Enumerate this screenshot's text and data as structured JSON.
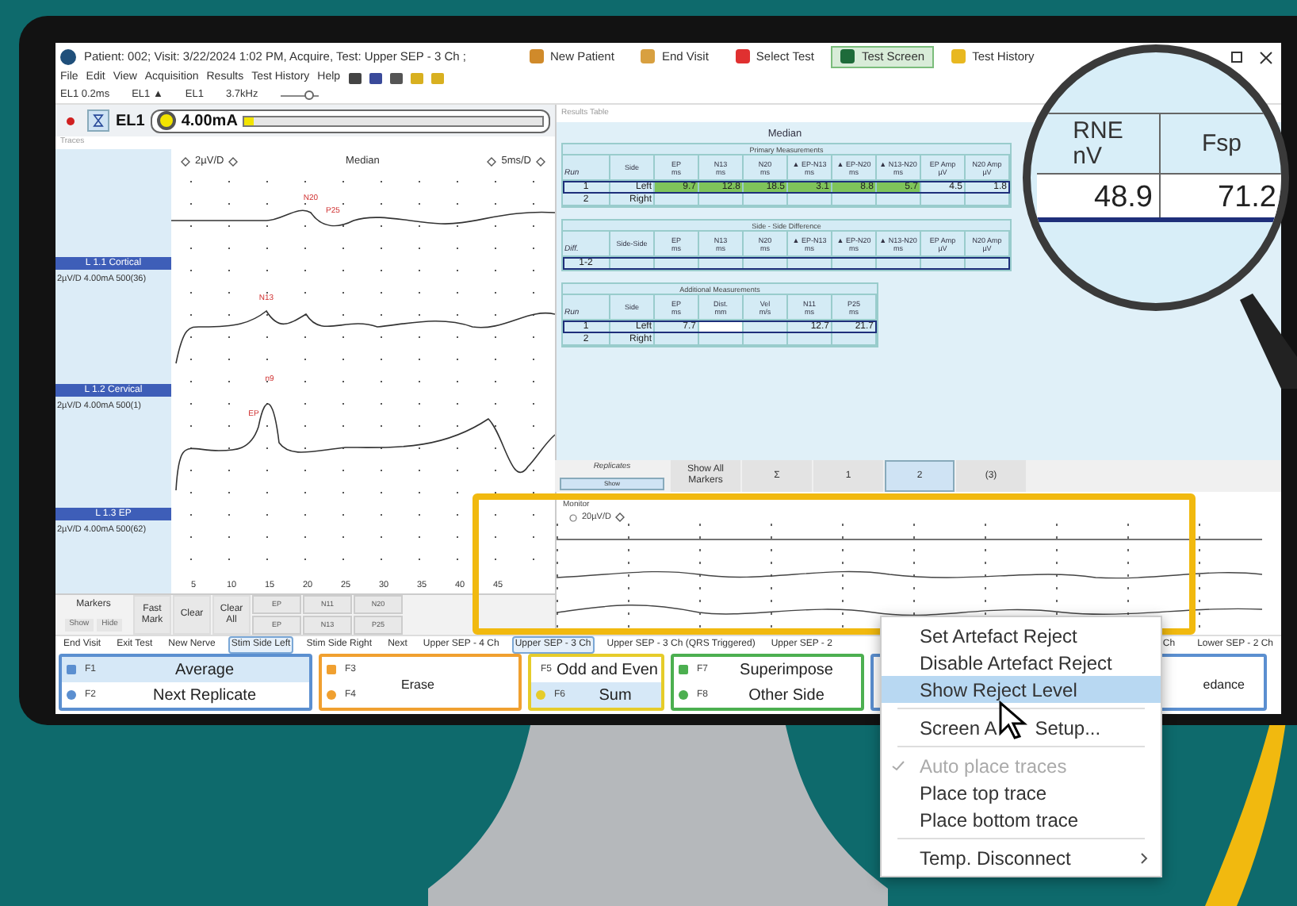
{
  "window": {
    "title": "Patient: 002;  Visit: 3/22/2024 1:02 PM, Acquire, Test: Upper SEP - 3 Ch ;"
  },
  "toolbar": [
    {
      "label": "New Patient",
      "selected": false
    },
    {
      "label": "End Visit",
      "selected": false
    },
    {
      "label": "Select Test",
      "selected": false
    },
    {
      "label": "Test Screen",
      "selected": true
    },
    {
      "label": "Test History",
      "selected": false
    }
  ],
  "menu": [
    "File",
    "Edit",
    "View",
    "Acquisition",
    "Results",
    "Test History",
    "Help"
  ],
  "settings_bar": {
    "fields": [
      "EL1 0.2ms",
      "EL1 ▲",
      "EL1",
      "3.7kHz"
    ],
    "level": 0.75
  },
  "stimulator": {
    "channel": "EL1",
    "current": "4.00mA",
    "level": 0.03
  },
  "traces": {
    "title": "Traces",
    "gain": "2µV/D",
    "mode": "Median",
    "timebase": "5ms/D",
    "channels": [
      {
        "name": "L 1.1 Cortical",
        "info": "2µV/D 4.00mA 500(36)",
        "markers": [
          "N20",
          "P25"
        ]
      },
      {
        "name": "L 1.2 Cervical",
        "info": "2µV/D 4.00mA 500(1)",
        "markers": [
          "N13"
        ]
      },
      {
        "name": "L 1.3 EP",
        "info": "2µV/D 4.00mA 500(62)",
        "markers": [
          "EP",
          "n9"
        ]
      }
    ],
    "x_ticks": [
      "5",
      "10",
      "15",
      "20",
      "25",
      "30",
      "35",
      "40",
      "45"
    ]
  },
  "markers_panel": {
    "title": "Markers",
    "show": "Show",
    "hide": "Hide",
    "buttons": [
      "Fast Mark",
      "Clear",
      "Clear All"
    ],
    "markers": [
      "EP",
      "N11",
      "N20",
      "EP",
      "N13",
      "P25"
    ]
  },
  "results": {
    "title": "Results Table",
    "heading": "Median",
    "tables": [
      {
        "title": "Primary Measurements",
        "columns": [
          {
            "name": "Run"
          },
          {
            "name": "Side"
          },
          {
            "name": "EP",
            "unit": "ms"
          },
          {
            "name": "N13",
            "unit": "ms"
          },
          {
            "name": "N20",
            "unit": "ms"
          },
          {
            "name": "▲ EP-N13",
            "unit": "ms"
          },
          {
            "name": "▲ EP-N20",
            "unit": "ms"
          },
          {
            "name": "▲ N13-N20",
            "unit": "ms"
          },
          {
            "name": "EP Amp",
            "unit": "µV"
          },
          {
            "name": "N20 Amp",
            "unit": "µV"
          }
        ],
        "rows": [
          {
            "selected": true,
            "cells": [
              {
                "text": "1",
                "highlighted": false
              },
              {
                "text": "Left",
                "highlighted": false
              },
              {
                "text": "9.7",
                "highlighted": true
              },
              {
                "text": "12.8",
                "highlighted": true
              },
              {
                "text": "18.5",
                "highlighted": true
              },
              {
                "text": "3.1",
                "highlighted": true
              },
              {
                "text": "8.8",
                "highlighted": true
              },
              {
                "text": "5.7",
                "highlighted": true
              },
              {
                "text": "4.5",
                "highlighted": false
              },
              {
                "text": "1.8",
                "highlighted": false
              }
            ]
          },
          {
            "selected": false,
            "cells": [
              {
                "text": "2",
                "highlighted": false
              },
              {
                "text": "Right",
                "highlighted": false
              }
            ]
          }
        ]
      },
      {
        "title": "Side - Side Difference",
        "columns": [
          {
            "name": "Diff."
          },
          {
            "name": "Side-Side"
          },
          {
            "name": "EP",
            "unit": "ms"
          },
          {
            "name": "N13",
            "unit": "ms"
          },
          {
            "name": "N20",
            "unit": "ms"
          },
          {
            "name": "▲ EP-N13",
            "unit": "ms"
          },
          {
            "name": "▲ EP-N20",
            "unit": "ms"
          },
          {
            "name": "▲ N13-N20",
            "unit": "ms"
          },
          {
            "name": "EP Amp",
            "unit": "µV"
          },
          {
            "name": "N20 Amp",
            "unit": "µV"
          }
        ],
        "rows": [
          {
            "selected": true,
            "cells": [
              {
                "text": "1-2",
                "highlighted": false
              }
            ]
          }
        ]
      },
      {
        "title": "Additional Measurements",
        "columns": [
          {
            "name": "Run"
          },
          {
            "name": "Side"
          },
          {
            "name": "EP",
            "unit": "ms"
          },
          {
            "name": "Dist.",
            "unit": "mm"
          },
          {
            "name": "Vel",
            "unit": "m/s"
          },
          {
            "name": "N11",
            "unit": "ms"
          },
          {
            "name": "P25",
            "unit": "ms"
          }
        ],
        "rows": [
          {
            "selected": true,
            "cells": [
              {
                "text": "1",
                "highlighted": false
              },
              {
                "text": "Left",
                "highlighted": false
              },
              {
                "text": "7.7",
                "highlighted": false
              },
              {
                "text": "",
                "editing": true
              },
              {
                "text": ""
              },
              {
                "text": "12.7",
                "highlighted": false
              },
              {
                "text": "21.7",
                "highlighted": false
              }
            ]
          },
          {
            "selected": false,
            "cells": [
              {
                "text": "2",
                "highlighted": false
              },
              {
                "text": "Right",
                "highlighted": false
              }
            ]
          }
        ]
      }
    ]
  },
  "magnifier": {
    "columns": [
      {
        "name": "RNE",
        "unit": "nV"
      },
      {
        "name": "Fsp"
      }
    ],
    "values": [
      "48.9",
      "71.2"
    ]
  },
  "replicates": {
    "title": "Replicates",
    "show": "Show",
    "tabs": [
      {
        "label": "Show All Markers",
        "selected": false
      },
      {
        "label": "Σ",
        "selected": false
      },
      {
        "label": "1",
        "selected": false
      },
      {
        "label": "2",
        "selected": true
      },
      {
        "label": "(3)",
        "selected": false
      }
    ]
  },
  "monitor": {
    "title": "Monitor",
    "gain": "20µV/D"
  },
  "protocol_bar": {
    "left": [
      {
        "label": "End Visit",
        "selected": false
      },
      {
        "label": "Exit Test",
        "selected": false
      },
      {
        "label": "New Nerve",
        "selected": false
      },
      {
        "label": "Stim Side Left",
        "selected": true
      },
      {
        "label": "Stim Side Right",
        "selected": false
      },
      {
        "label": "Next",
        "selected": false
      },
      {
        "label": "Upper SEP - 4 Ch",
        "selected": false
      },
      {
        "label": "Upper SEP - 3 Ch",
        "selected": true
      },
      {
        "label": "Upper SEP - 3 Ch (QRS Triggered)",
        "selected": false
      },
      {
        "label": "Upper SEP - 2",
        "selected": false
      }
    ],
    "right": [
      {
        "label": "Ch",
        "selected": false
      },
      {
        "label": "Lower SEP - 2 Ch",
        "selected": false
      }
    ]
  },
  "function_keys": [
    {
      "color": "#5b8fd0",
      "keys": [
        {
          "key": "F1",
          "label": "Average",
          "selected": true
        },
        {
          "key": "F2",
          "label": "Next Replicate",
          "selected": false
        }
      ]
    },
    {
      "color": "#f0a030",
      "merged": "Erase",
      "keys": [
        {
          "key": "F3",
          "selected": false
        },
        {
          "key": "F4",
          "selected": false
        }
      ]
    },
    {
      "color": "#e6cc2a",
      "keys": [
        {
          "key": "F5",
          "label": "Odd and Even",
          "selected": false
        },
        {
          "key": "F6",
          "label": "Sum",
          "selected": true
        }
      ]
    },
    {
      "color": "#4caf50",
      "keys": [
        {
          "key": "F7",
          "label": "Superimpose",
          "selected": false
        },
        {
          "key": "F8",
          "label": "Other Side",
          "selected": false
        }
      ]
    },
    {
      "color": "#5b8fd0",
      "merged": "edance"
    }
  ],
  "context_menu": [
    {
      "kind": "item",
      "label": "Set Artefact Reject",
      "selected": false
    },
    {
      "kind": "item",
      "label": "Disable Artefact Reject",
      "selected": false
    },
    {
      "kind": "item",
      "label": "Show Reject Level",
      "selected": true
    },
    {
      "kind": "separator"
    },
    {
      "kind": "item",
      "label": "Screen A",
      "label_after": "Setup...",
      "selected": false
    },
    {
      "kind": "separator"
    },
    {
      "kind": "check",
      "label": "Auto place traces",
      "checked": true,
      "disabled": true
    },
    {
      "kind": "item",
      "label": "Place top trace",
      "selected": false
    },
    {
      "kind": "item",
      "label": "Place bottom trace",
      "selected": false
    },
    {
      "kind": "separator"
    },
    {
      "kind": "submenu",
      "label": "Temp. Disconnect",
      "selected": false
    }
  ]
}
